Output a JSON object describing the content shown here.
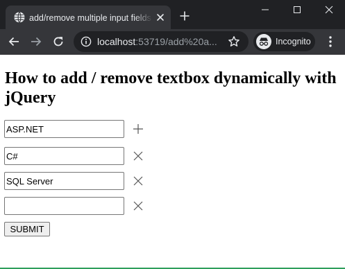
{
  "browser": {
    "tab": {
      "title": "add/remove multiple input fields",
      "favicon_icon": "globe-icon",
      "close_icon": "close-icon"
    },
    "new_tab_icon": "plus-icon",
    "window_controls": [
      "minimize-icon",
      "maximize-icon",
      "close-icon"
    ],
    "toolbar": {
      "back_icon": "arrow-left-icon",
      "forward_icon": "arrow-right-icon",
      "reload_icon": "reload-icon",
      "address": {
        "host": "localhost",
        "rest": ":53719/add%20a..."
      },
      "site_info_icon": "info-icon",
      "bookmark_icon": "star-icon",
      "profile": {
        "label": "Incognito",
        "icon": "incognito-icon"
      },
      "menu_icon": "more-vert-icon"
    }
  },
  "page": {
    "title": "How to add / remove textbox dynamically with jQuery",
    "fields": [
      {
        "value": "ASP.NET",
        "action": "add",
        "action_icon": "plus-icon"
      },
      {
        "value": "C#",
        "action": "remove",
        "action_icon": "close-icon"
      },
      {
        "value": "SQL Server",
        "action": "remove",
        "action_icon": "close-icon"
      },
      {
        "value": "",
        "action": "remove",
        "action_icon": "close-icon"
      }
    ],
    "submit_label": "SUBMIT"
  },
  "colors": {
    "tabstrip": "#202124",
    "toolbar": "#35363a",
    "text_light": "#e8eaed",
    "text_dim": "#9aa0a6",
    "input_border": "#767676"
  }
}
